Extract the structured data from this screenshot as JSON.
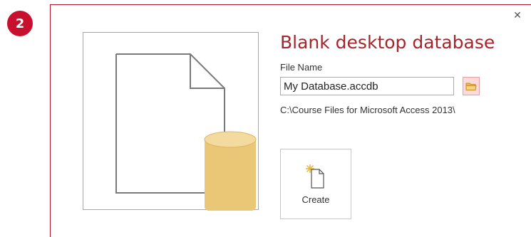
{
  "step": {
    "number": "2"
  },
  "dialog": {
    "close_glyph": "✕",
    "title": "Blank desktop database",
    "file_name_label": "File Name",
    "file_name_value": "My Database.accdb",
    "path": "C:\\Course Files for Microsoft Access 2013\\",
    "create_label": "Create",
    "icons": {
      "preview": "blank-document-with-database-icon",
      "browse": "folder-icon",
      "create": "new-document-icon"
    }
  },
  "colors": {
    "badge": "#c8102e",
    "title": "#a4262c",
    "database": "#e8c070",
    "browse_bg": "#fbdada"
  }
}
